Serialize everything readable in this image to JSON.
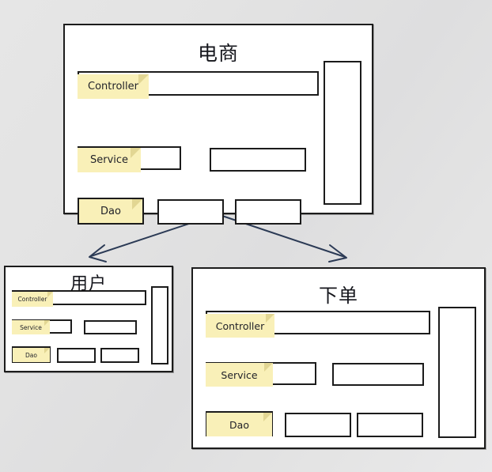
{
  "diagram": {
    "title_visible": false,
    "background_color": "#e3e3e3",
    "note_color": "#f9f0b8",
    "note_fold_color": "#e2d693",
    "box_border_color": "#1b1b1b",
    "arrow_color": "#2b3a55"
  },
  "modules": [
    {
      "id": "ecommerce",
      "title": "电商",
      "layers": [
        {
          "name": "Controller",
          "note_label": "Controller"
        },
        {
          "name": "Service",
          "note_label": "Service"
        },
        {
          "name": "Dao",
          "note_label": "Dao"
        }
      ],
      "slot_counts": {
        "controller": 1,
        "service": 2,
        "dao": 3
      },
      "has_side_column": true
    },
    {
      "id": "user",
      "title": "用户",
      "layers": [
        {
          "name": "Controller",
          "note_label": "Controller"
        },
        {
          "name": "Service",
          "note_label": "Service"
        },
        {
          "name": "Dao",
          "note_label": "Dao"
        }
      ],
      "slot_counts": {
        "controller": 1,
        "service": 2,
        "dao": 3
      },
      "has_side_column": true
    },
    {
      "id": "order",
      "title": "下单",
      "layers": [
        {
          "name": "Controller",
          "note_label": "Controller"
        },
        {
          "name": "Service",
          "note_label": "Service"
        },
        {
          "name": "Dao",
          "note_label": "Dao"
        }
      ],
      "slot_counts": {
        "controller": 1,
        "service": 2,
        "dao": 3
      },
      "has_side_column": true
    }
  ],
  "connections": [
    {
      "from": "ecommerce",
      "to": "user",
      "style": "arrow"
    },
    {
      "from": "ecommerce",
      "to": "order",
      "style": "arrow"
    }
  ]
}
